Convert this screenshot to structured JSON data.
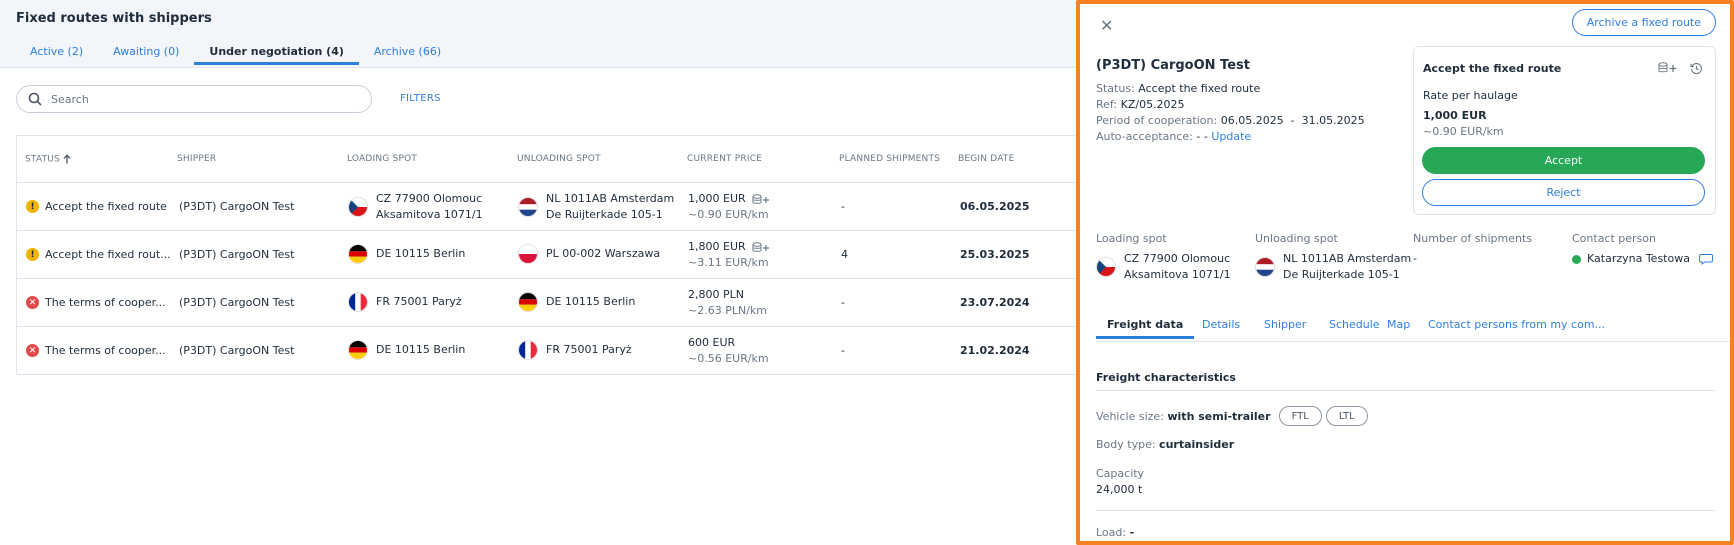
{
  "header": {
    "title": "Fixed routes with shippers",
    "tabs": [
      {
        "label": "Active (2)"
      },
      {
        "label": "Awaiting (0)"
      },
      {
        "label": "Under negotiation (4)"
      },
      {
        "label": "Archive (66)"
      }
    ]
  },
  "search": {
    "placeholder": "Search",
    "filters_label": "FILTERS"
  },
  "table": {
    "columns": [
      "STATUS",
      "SHIPPER",
      "LOADING SPOT",
      "UNLOADING SPOT",
      "CURRENT PRICE",
      "PLANNED SHIPMENTS",
      "BEGIN DATE"
    ],
    "rows": [
      {
        "status": "Accept the fixed route",
        "status_type": "warning",
        "shipper": "(P3DT) CargoON Test",
        "loading_line1": "CZ 77900 Olomouc",
        "loading_line2": "Aksamitova 1071/1",
        "loading_flag": "cz",
        "unloading_line1": "NL 1011AB Amsterdam",
        "unloading_line2": "De Ruijterkade 105-1",
        "unloading_flag": "nl",
        "price": "1,000 EUR",
        "price_sub": "~0.90 EUR/km",
        "shipments": "-",
        "begin": "06.05.2025"
      },
      {
        "status": "Accept the fixed rout...",
        "status_type": "warning",
        "shipper": "(P3DT) CargoON Test",
        "loading_line1": "DE 10115 Berlin",
        "loading_line2": "",
        "loading_flag": "de",
        "unloading_line1": "PL 00-002 Warszawa",
        "unloading_line2": "",
        "unloading_flag": "pl",
        "price": "1,800 EUR",
        "price_sub": "~3.11 EUR/km",
        "shipments": "4",
        "begin": "25.03.2025"
      },
      {
        "status": "The terms of cooper...",
        "status_type": "error",
        "shipper": "(P3DT) CargoON Test",
        "loading_line1": "FR 75001 Paryż",
        "loading_line2": "",
        "loading_flag": "fr",
        "unloading_line1": "DE 10115 Berlin",
        "unloading_line2": "",
        "unloading_flag": "de",
        "price": "2,800 PLN",
        "price_sub": "~2.63 PLN/km",
        "shipments": "-",
        "begin": "23.07.2024"
      },
      {
        "status": "The terms of cooper...",
        "status_type": "error",
        "shipper": "(P3DT) CargoON Test",
        "loading_line1": "DE 10115 Berlin",
        "loading_line2": "",
        "loading_flag": "de",
        "unloading_line1": "FR 75001 Paryż",
        "unloading_line2": "",
        "unloading_flag": "fr",
        "price": "600 EUR",
        "price_sub": "~0.56 EUR/km",
        "shipments": "-",
        "begin": "21.02.2024"
      }
    ]
  },
  "panel": {
    "archive_label": "Archive a fixed route",
    "title": "(P3DT) CargoON Test",
    "status_key": "Status:",
    "status_val": "Accept the fixed route",
    "ref_key": "Ref:",
    "ref_val": "KZ/05.2025",
    "period_key": "Period of cooperation:",
    "period_val": "06.05.2025  -  31.05.2025",
    "auto_key": "Auto-acceptance:",
    "auto_val": "-",
    "auto_link": "Update",
    "card": {
      "title": "Accept the fixed route",
      "rate_label": "Rate per haulage",
      "rate_val": "1,000 EUR",
      "rate_sub": "~0.90 EUR/km",
      "accept_label": "Accept",
      "reject_label": "Reject"
    },
    "loading_label": "Loading spot",
    "loading_line1": "CZ 77900 Olomouc",
    "loading_line2": "Aksamitova 1071/1",
    "unloading_label": "Unloading spot",
    "unloading_line1": "NL 1011AB Amsterdam",
    "unloading_line2": "De Ruijterkade 105-1",
    "shipments_label": "Number of shipments",
    "shipments_val": "-",
    "contact_label": "Contact person",
    "contact_val": "Katarzyna Testowa",
    "tabs": [
      {
        "label": "Freight data"
      },
      {
        "label": "Details"
      },
      {
        "label": "Shipper"
      },
      {
        "label": "Schedule"
      },
      {
        "label": "Map"
      },
      {
        "label": "Contact persons from my com..."
      }
    ],
    "freight_title": "Freight characteristics",
    "vehicle_key": "Vehicle size:",
    "vehicle_val": "with semi-trailer",
    "pill_ftl": "FTL",
    "pill_ltl": "LTL",
    "body_key": "Body type:",
    "body_val": "curtainsider",
    "capacity_key": "Capacity",
    "capacity_val": "24,000 t",
    "load_key": "Load:",
    "load_val": "-"
  },
  "colors": {
    "accent": "#2f7fe0",
    "accept": "#27a857",
    "panel_border": "#f7811f",
    "warning": "#f0b400",
    "error": "#e04a4a"
  }
}
